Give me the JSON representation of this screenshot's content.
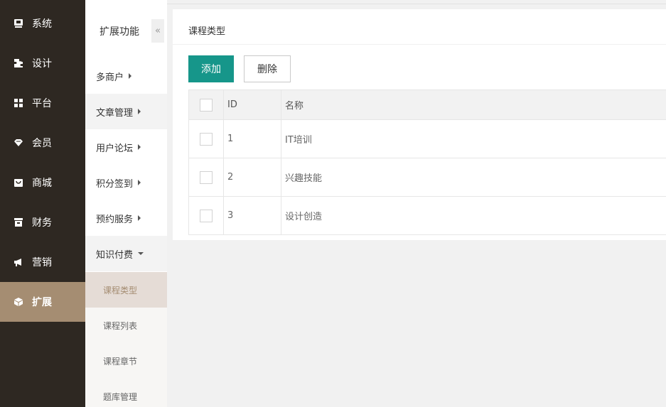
{
  "nav1": {
    "items": [
      {
        "label": "系统",
        "icon": "monitor-icon"
      },
      {
        "label": "设计",
        "icon": "puzzle-icon"
      },
      {
        "label": "平台",
        "icon": "grid-icon"
      },
      {
        "label": "会员",
        "icon": "gem-icon"
      },
      {
        "label": "商城",
        "icon": "bag-icon"
      },
      {
        "label": "财务",
        "icon": "archive-icon"
      },
      {
        "label": "营销",
        "icon": "megaphone-icon"
      },
      {
        "label": "扩展",
        "icon": "cube-icon"
      }
    ],
    "active_index": 7,
    "active_color": "#a58d72"
  },
  "nav2": {
    "title": "扩展功能",
    "collapse_glyph": "«",
    "items": [
      {
        "label": "多商户"
      },
      {
        "label": "文章管理"
      },
      {
        "label": "用户论坛"
      },
      {
        "label": "积分签到"
      },
      {
        "label": "预约服务"
      },
      {
        "label": "知识付费"
      }
    ],
    "subitems": [
      {
        "label": "课程类型"
      },
      {
        "label": "课程列表"
      },
      {
        "label": "课程章节"
      },
      {
        "label": "题库管理"
      }
    ]
  },
  "panel": {
    "title": "课程类型",
    "add_label": "添加",
    "delete_label": "删除",
    "primary_color": "#16968a"
  },
  "table": {
    "headers": {
      "id": "ID",
      "name": "名称"
    },
    "rows": [
      {
        "id": "1",
        "name": "IT培训"
      },
      {
        "id": "2",
        "name": "兴趣技能"
      },
      {
        "id": "3",
        "name": "设计创造"
      }
    ]
  }
}
